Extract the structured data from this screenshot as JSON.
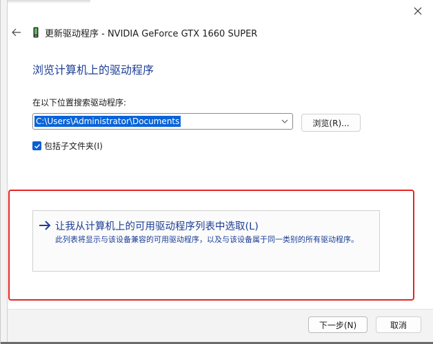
{
  "window": {
    "title": "更新驱动程序 - NVIDIA GeForce GTX 1660 SUPER",
    "close_icon": "close-icon",
    "back_icon": "back-arrow-icon",
    "device_icon": "device-icon"
  },
  "main": {
    "heading": "浏览计算机上的驱动程序",
    "search_label": "在以下位置搜索驱动程序:",
    "path_value": "C:\\Users\\Administrator\\Documents",
    "browse_label": "浏览(R)...",
    "include_subfolders_label": "包括子文件夹(I)",
    "include_subfolders_checked": true
  },
  "pick_option": {
    "title": "让我从计算机上的可用驱动程序列表中选取(L)",
    "description": "此列表将显示与该设备兼容的可用驱动程序，以及与该设备属于同一类别的所有驱动程序。",
    "arrow_icon": "right-arrow-icon",
    "highlight_color": "#e52424"
  },
  "footer": {
    "next_label": "下一步(N)",
    "cancel_label": "取消"
  },
  "colors": {
    "link_blue": "#1c3e96",
    "selection_blue": "#0a64d8",
    "checkbox_blue": "#0a5fd0"
  }
}
